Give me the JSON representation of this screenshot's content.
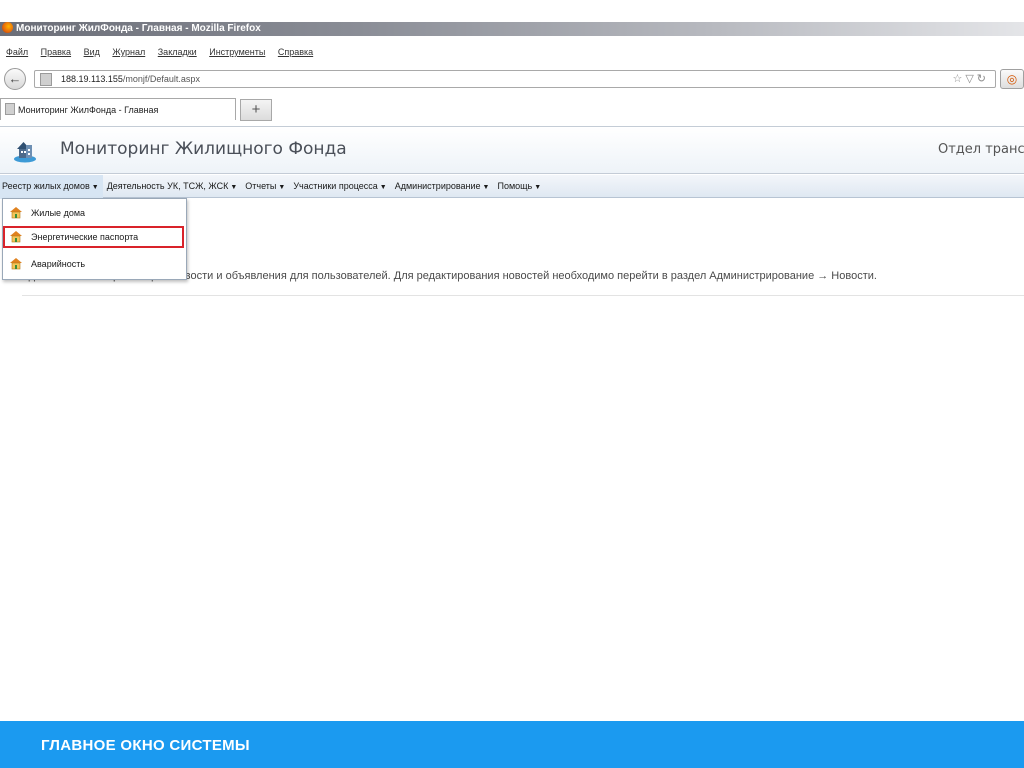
{
  "browser": {
    "window_title": "Мониторинг ЖилФонда - Главная - Mozilla Firefox",
    "menu": [
      "Файл",
      "Правка",
      "Вид",
      "Журнал",
      "Закладки",
      "Инструменты",
      "Справка"
    ],
    "url_host": "188.19.113.155",
    "url_path": "/monjf/Default.aspx",
    "tab_title": "Мониторинг ЖилФонда - Главная",
    "new_tab_label": "+"
  },
  "app": {
    "title": "Мониторинг Жилищного Фонда",
    "department": "Отдел транс",
    "menu": [
      {
        "label": "Реестр жилых домов"
      },
      {
        "label": "Деятельность УК, ТСЖ, ЖСК"
      },
      {
        "label": "Отчеты"
      },
      {
        "label": "Участники процесса"
      },
      {
        "label": "Администрирование"
      },
      {
        "label": "Помощь"
      }
    ],
    "dropdown": [
      {
        "label": "Жилые дома"
      },
      {
        "label": "Энергетические паспорта"
      },
      {
        "label": "Аварийность"
      }
    ],
    "content_text": "Здесь вы можете размещать новости и объявления для пользователей. Для редактирования новостей необходимо перейти в раздел Администрирование → Новости."
  },
  "footer": {
    "caption": "ГЛАВНОЕ ОКНО СИСТЕМЫ",
    "color": "#1b9af0"
  },
  "colors": {
    "highlight_border": "#d9232a"
  }
}
